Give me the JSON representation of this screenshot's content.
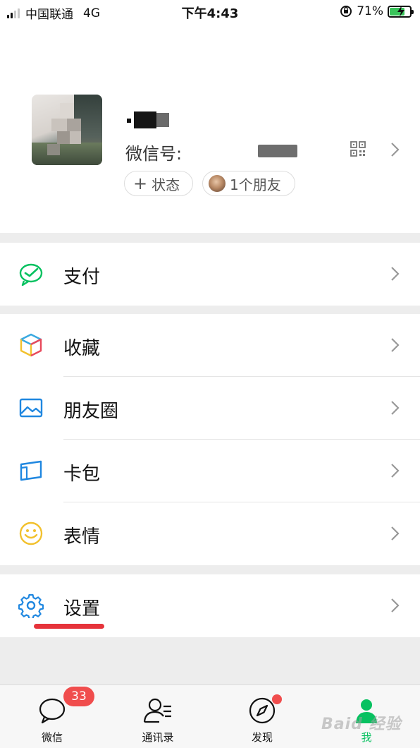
{
  "status_bar": {
    "carrier": "中国联通",
    "network": "4G",
    "time": "下午4:43",
    "battery": "71%",
    "battery_level": 0.71
  },
  "profile": {
    "wechat_id_label": "微信号:",
    "status_label": "状态",
    "friends_label": "1个朋友"
  },
  "menu": {
    "pay": "支付",
    "favorites": "收藏",
    "moments": "朋友圈",
    "cards": "卡包",
    "stickers": "表情",
    "settings": "设置"
  },
  "tabbar": {
    "chats": "微信",
    "chats_badge": "33",
    "contacts": "通讯录",
    "discover": "发现",
    "me": "我",
    "active_color": "#07c160"
  },
  "watermark": "Baid 经验"
}
